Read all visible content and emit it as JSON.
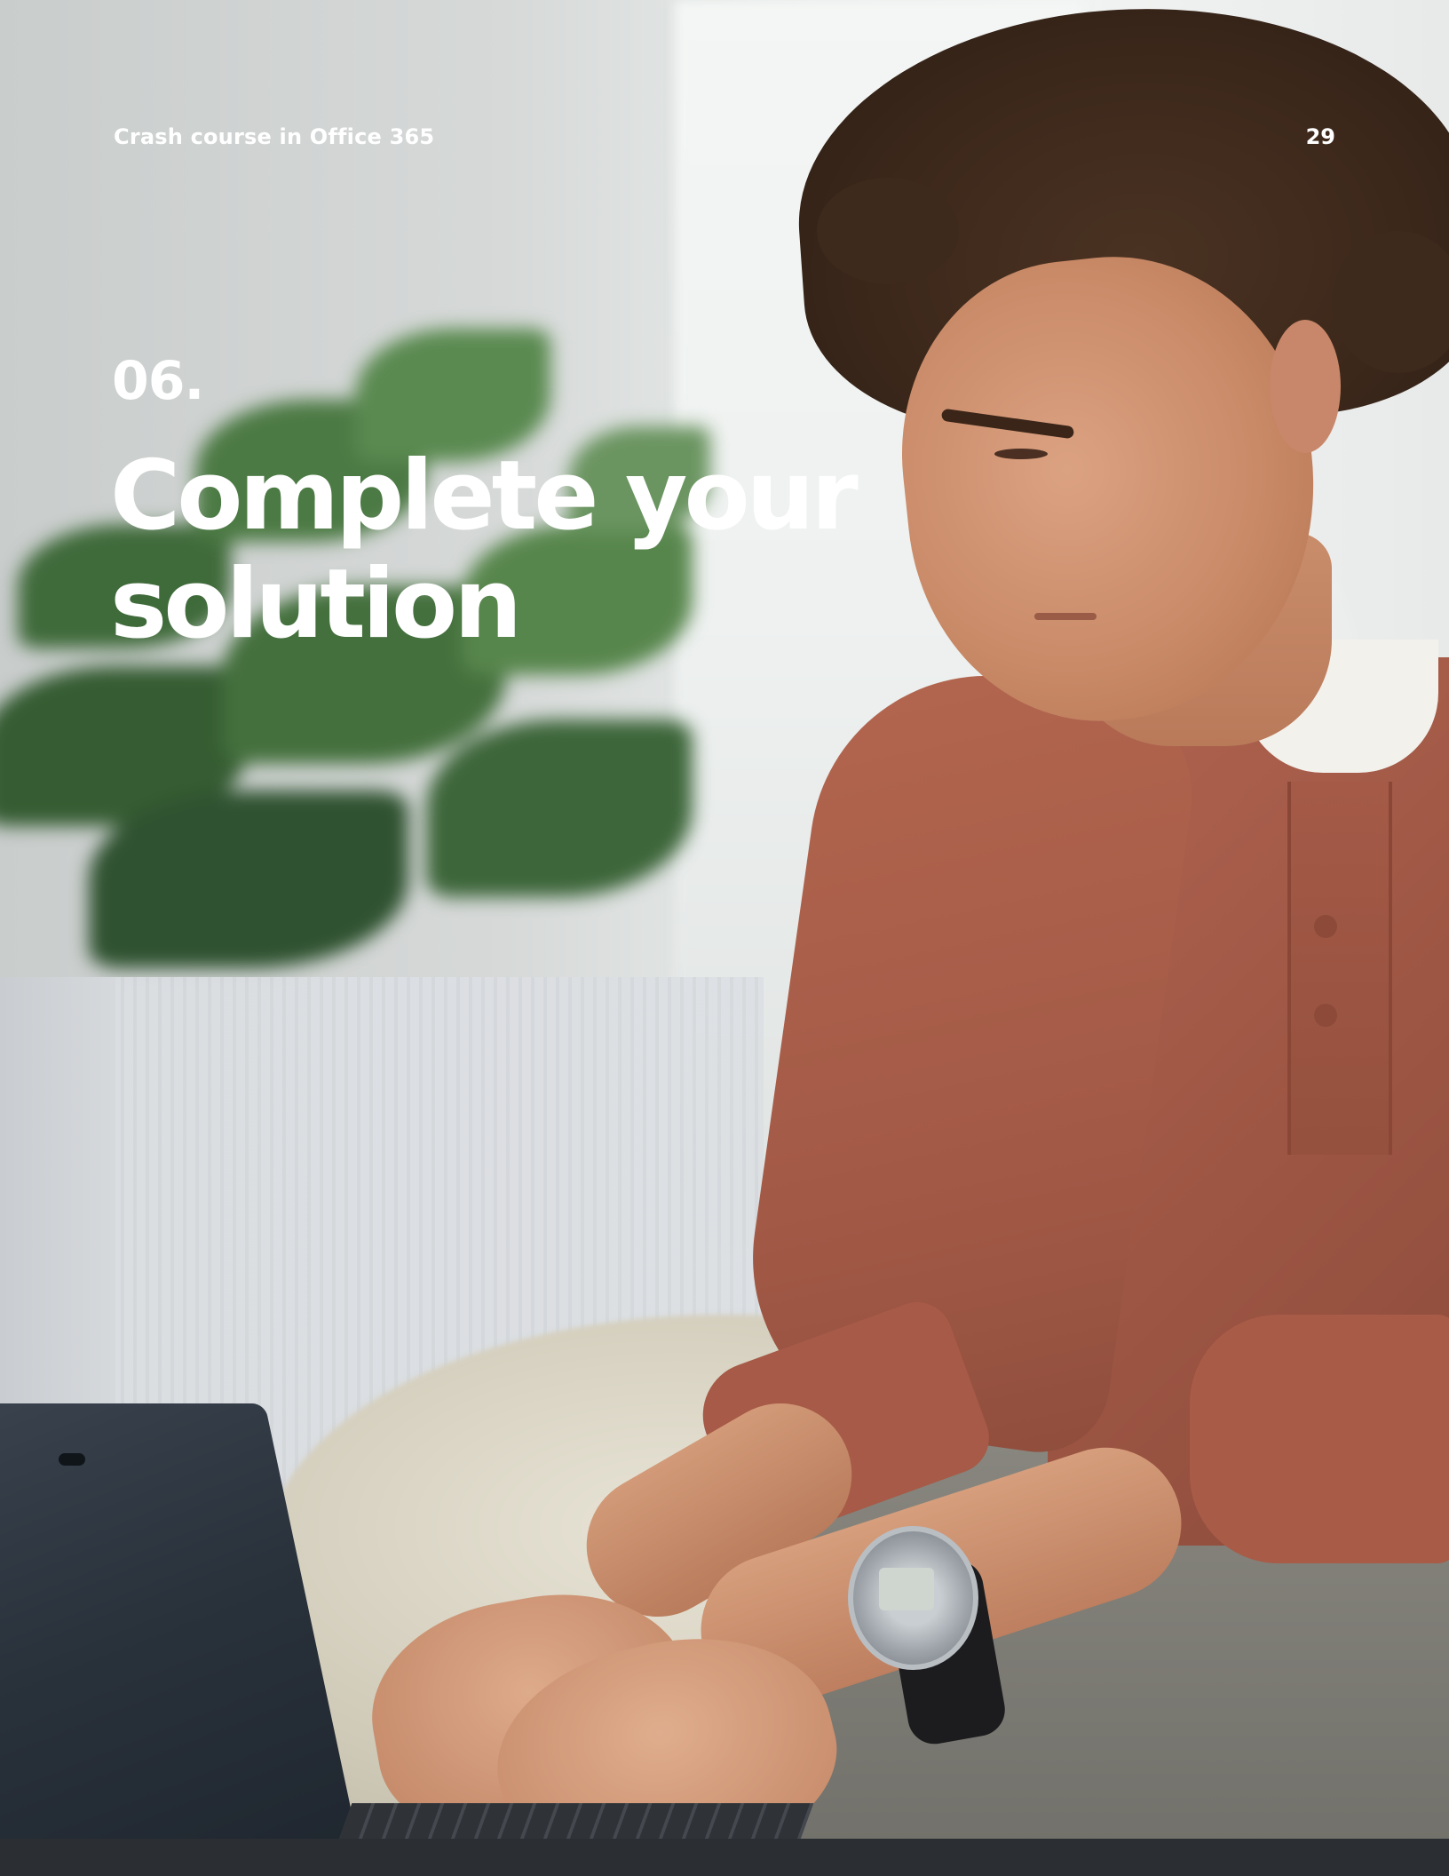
{
  "header": {
    "title": "Crash course in Office 365",
    "page_number": "29"
  },
  "section": {
    "number": "06.",
    "title": "Complete your solution"
  },
  "colors": {
    "text": "#ffffff",
    "shirt": "#a85b47"
  }
}
